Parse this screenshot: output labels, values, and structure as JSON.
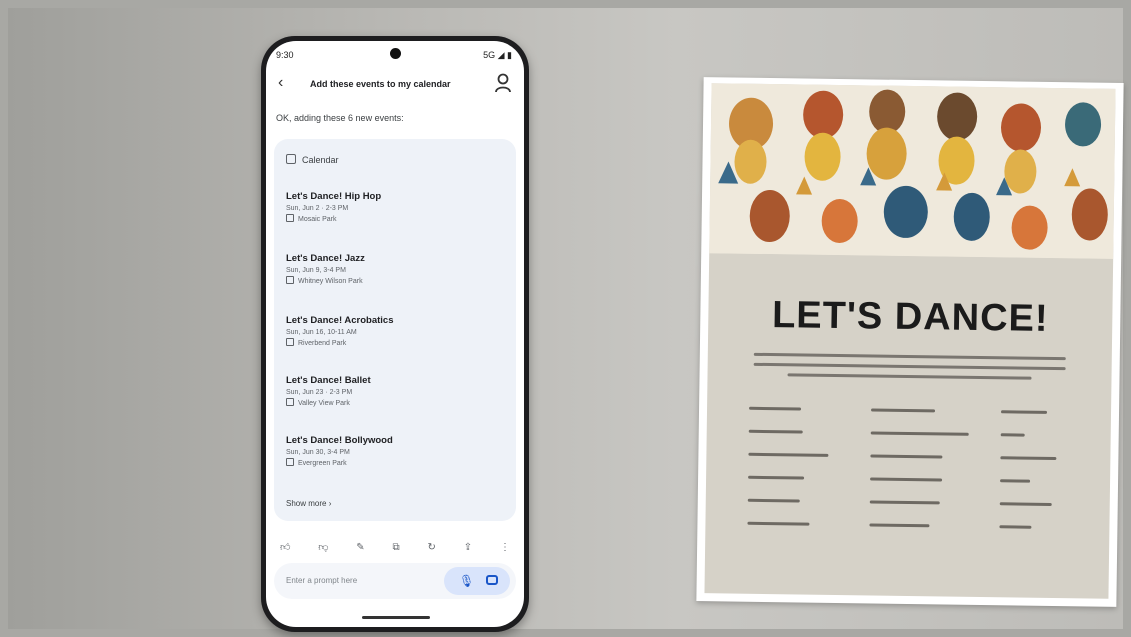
{
  "status": {
    "time": "9:30",
    "signal": "5G"
  },
  "appbar": {
    "title": "Add these events to my calendar"
  },
  "reply": "OK, adding these 6 new events:",
  "calendar_chip": "Calendar",
  "events": [
    {
      "title": "Let's Dance! Hip Hop",
      "date": "Sun, Jun 2 · 2-3 PM",
      "location": "Mosaic Park"
    },
    {
      "title": "Let's Dance! Jazz",
      "date": "Sun, Jun 9, 3-4 PM",
      "location": "Whitney Wilson Park"
    },
    {
      "title": "Let's Dance! Acrobatics",
      "date": "Sun, Jun 16, 10-11 AM",
      "location": "Riverbend Park"
    },
    {
      "title": "Let's Dance! Ballet",
      "date": "Sun, Jun 23 · 2-3 PM",
      "location": "Valley View Park"
    },
    {
      "title": "Let's Dance! Bollywood",
      "date": "Sun, Jun 30, 3-4 PM",
      "location": "Evergreen Park"
    }
  ],
  "show_more": "Show more",
  "prompt": {
    "placeholder": "Enter a prompt here"
  },
  "poster": {
    "title": "LET'S DANCE!"
  },
  "colors": {
    "accent": "#1a56c8",
    "card_bg": "#eef2f8",
    "poster_bg": "#d6d2c8"
  }
}
